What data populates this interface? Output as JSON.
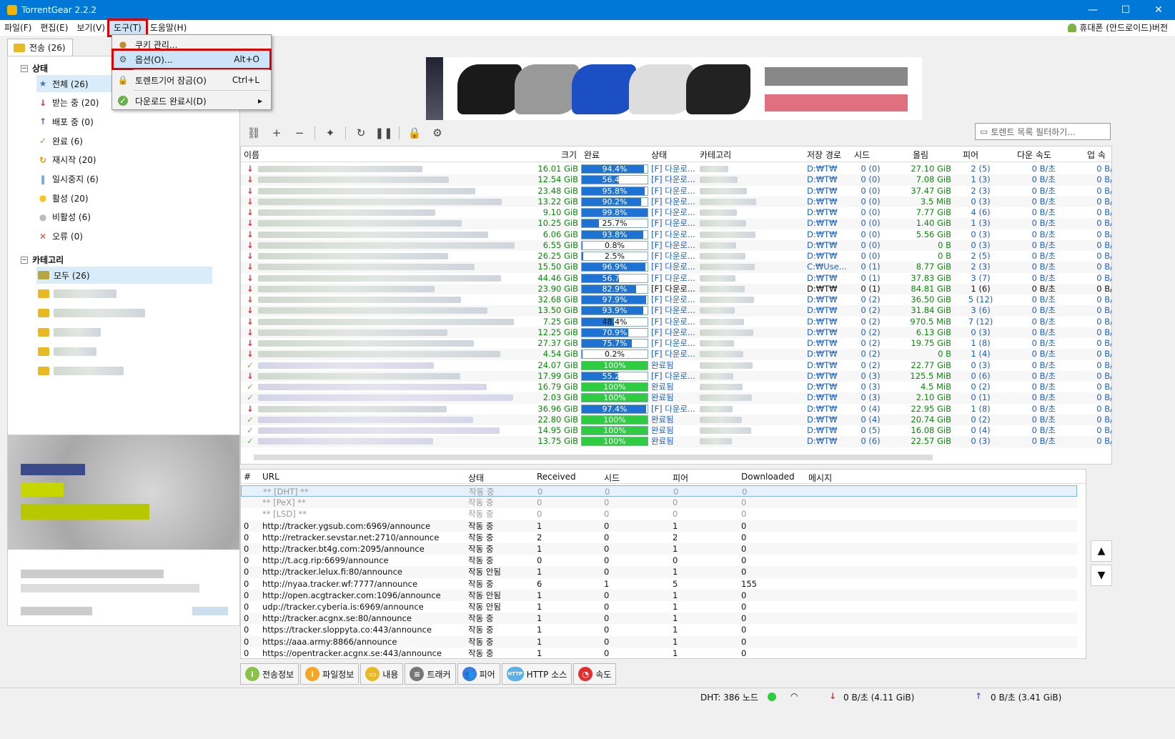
{
  "window": {
    "title": "TorrentGear 2.2.2",
    "minimize": "—",
    "maximize": "☐",
    "close": "✕"
  },
  "menu": {
    "items": [
      "파일(F)",
      "편집(E)",
      "보기(V)",
      "도구(T)",
      "도움말(H)"
    ],
    "mobile": "휴대폰 (안드로이드)버전"
  },
  "tab": {
    "label": "전송 (26)"
  },
  "dropdown": {
    "items": [
      {
        "label": "쿠키 관리...",
        "shortcut": ""
      },
      {
        "label": "옵션(O)...",
        "shortcut": "Alt+O"
      },
      {
        "label": "토렌트기어 잠금(O)",
        "shortcut": "Ctrl+L"
      },
      {
        "label": "다운로드 완료시(D)",
        "shortcut": "▸"
      }
    ]
  },
  "tree": {
    "status_title": "상태",
    "status": [
      {
        "label": "전체 (26)",
        "icon": "★",
        "color": "#4a78b8"
      },
      {
        "label": "받는 중 (20)",
        "icon": "↓",
        "color": "#e03030"
      },
      {
        "label": "배포 중 (0)",
        "icon": "↑",
        "color": "#6a5acd"
      },
      {
        "label": "완료 (6)",
        "icon": "✓",
        "color": "#6ab04c"
      },
      {
        "label": "재시작 (20)",
        "icon": "↻",
        "color": "#f08c00"
      },
      {
        "label": "일시중지 (6)",
        "icon": "‖",
        "color": "#1e90ff"
      },
      {
        "label": "활성 (20)",
        "icon": "●",
        "color": "#f5c518"
      },
      {
        "label": "비활성 (6)",
        "icon": "●",
        "color": "#bbbbbb"
      },
      {
        "label": "오류 (0)",
        "icon": "✕",
        "color": "#e8452c"
      }
    ],
    "category_title": "카테고리",
    "categories": [
      {
        "label": "모두 (26)"
      }
    ]
  },
  "filter": {
    "placeholder": "토렌트 목록 필터하기..."
  },
  "grid": {
    "headers": {
      "name": "이름",
      "size": "크기",
      "done": "완료",
      "state": "상태",
      "cat": "카테고리",
      "path": "저장 경로",
      "seed": "시드",
      "up": "올림",
      "peer": "피어",
      "dl": "다운 속도",
      "ul": "업 속"
    },
    "rows": [
      {
        "t": "d",
        "size": "16.01 GiB",
        "pct": 94.4,
        "pcttxt": "94.4%",
        "state": "[F] 다운로...",
        "path": "D:₩T₩",
        "seed": "0 (0)",
        "up": "27.10 GiB",
        "peer": "2 (5)",
        "dl": "0 B/초",
        "ul": "0 B/"
      },
      {
        "t": "d",
        "size": "12.54 GiB",
        "pct": 56.4,
        "pcttxt": "56.4%",
        "state": "[F] 다운로...",
        "path": "D:₩T₩",
        "seed": "0 (0)",
        "up": "7.08 GiB",
        "peer": "1 (3)",
        "dl": "0 B/초",
        "ul": "0 B/"
      },
      {
        "t": "d",
        "size": "23.48 GiB",
        "pct": 95.8,
        "pcttxt": "95.8%",
        "state": "[F] 다운로...",
        "path": "D:₩T₩",
        "seed": "0 (0)",
        "up": "37.47 GiB",
        "peer": "2 (3)",
        "dl": "0 B/초",
        "ul": "0 B/"
      },
      {
        "t": "d",
        "size": "13.22 GiB",
        "pct": 90.2,
        "pcttxt": "90.2%",
        "state": "[F] 다운로...",
        "path": "D:₩T₩",
        "seed": "0 (0)",
        "up": "3.5 MiB",
        "peer": "0 (3)",
        "dl": "0 B/초",
        "ul": "0 B/"
      },
      {
        "t": "d",
        "size": "9.10 GiB",
        "pct": 99.8,
        "pcttxt": "99.8%",
        "state": "[F] 다운로...",
        "path": "D:₩T₩",
        "seed": "0 (0)",
        "up": "7.77 GiB",
        "peer": "4 (6)",
        "dl": "0 B/초",
        "ul": "0 B/"
      },
      {
        "t": "d",
        "size": "10.25 GiB",
        "pct": 25.7,
        "pcttxt": "25.7%",
        "state": "[F] 다운로...",
        "path": "D:₩T₩",
        "seed": "0 (0)",
        "up": "1.40 GiB",
        "peer": "1 (3)",
        "dl": "0 B/초",
        "ul": "0 B/"
      },
      {
        "t": "d",
        "size": "6.06 GiB",
        "pct": 93.8,
        "pcttxt": "93.8%",
        "state": "[F] 다운로...",
        "path": "D:₩T₩",
        "seed": "0 (0)",
        "up": "5.56 GiB",
        "peer": "0 (3)",
        "dl": "0 B/초",
        "ul": "0 B/"
      },
      {
        "t": "d",
        "size": "6.55 GiB",
        "pct": 0.8,
        "pcttxt": "0.8%",
        "state": "[F] 다운로...",
        "path": "D:₩T₩",
        "seed": "0 (0)",
        "up": "0 B",
        "peer": "0 (3)",
        "dl": "0 B/초",
        "ul": "0 B/"
      },
      {
        "t": "d",
        "size": "26.25 GiB",
        "pct": 2.5,
        "pcttxt": "2.5%",
        "state": "[F] 다운로...",
        "path": "D:₩T₩",
        "seed": "0 (0)",
        "up": "0 B",
        "peer": "2 (5)",
        "dl": "0 B/초",
        "ul": "0 B/"
      },
      {
        "t": "d",
        "size": "15.50 GiB",
        "pct": 96.9,
        "pcttxt": "96.9%",
        "state": "[F] 다운로...",
        "path": "C:₩Use...",
        "seed": "0 (1)",
        "up": "8.77 GiB",
        "peer": "2 (3)",
        "dl": "0 B/초",
        "ul": "0 B/"
      },
      {
        "t": "d",
        "size": "44.46 GiB",
        "pct": 56.7,
        "pcttxt": "56.7%",
        "state": "[F] 다운로...",
        "path": "D:₩T₩",
        "seed": "0 (1)",
        "up": "37.83 GiB",
        "peer": "3 (7)",
        "dl": "0 B/초",
        "ul": "0 B/"
      },
      {
        "t": "d",
        "size": "23.90 GiB",
        "pct": 82.9,
        "pcttxt": "82.9%",
        "state": "[F] 다운로...",
        "path": "D:₩T₩",
        "seed": "0 (1)",
        "up": "84.81 GiB",
        "peer": "1 (6)",
        "dl": "0 B/초",
        "ul": "0 B/",
        "dark": true
      },
      {
        "t": "d",
        "size": "32.68 GiB",
        "pct": 97.9,
        "pcttxt": "97.9%",
        "state": "[F] 다운로...",
        "path": "D:₩T₩",
        "seed": "0 (2)",
        "up": "36.50 GiB",
        "peer": "5 (12)",
        "dl": "0 B/초",
        "ul": "0 B/"
      },
      {
        "t": "d",
        "size": "13.50 GiB",
        "pct": 93.9,
        "pcttxt": "93.9%",
        "state": "[F] 다운로...",
        "path": "D:₩T₩",
        "seed": "0 (2)",
        "up": "31.84 GiB",
        "peer": "3 (6)",
        "dl": "0 B/초",
        "ul": "0 B/"
      },
      {
        "t": "d",
        "size": "7.25 GiB",
        "pct": 48.4,
        "pcttxt": "48.4%",
        "state": "[F] 다운로...",
        "path": "D:₩T₩",
        "seed": "0 (2)",
        "up": "970.5 MiB",
        "peer": "7 (12)",
        "dl": "0 B/초",
        "ul": "0 B/"
      },
      {
        "t": "d",
        "size": "12.25 GiB",
        "pct": 70.9,
        "pcttxt": "70.9%",
        "state": "[F] 다운로...",
        "path": "D:₩T₩",
        "seed": "0 (2)",
        "up": "6.13 GiB",
        "peer": "0 (3)",
        "dl": "0 B/초",
        "ul": "0 B/"
      },
      {
        "t": "d",
        "size": "27.37 GiB",
        "pct": 75.7,
        "pcttxt": "75.7%",
        "state": "[F] 다운로...",
        "path": "D:₩T₩",
        "seed": "0 (2)",
        "up": "19.75 GiB",
        "peer": "1 (8)",
        "dl": "0 B/초",
        "ul": "0 B/"
      },
      {
        "t": "d",
        "size": "4.54 GiB",
        "pct": 0.2,
        "pcttxt": "0.2%",
        "state": "[F] 다운로...",
        "path": "D:₩T₩",
        "seed": "0 (2)",
        "up": "0 B",
        "peer": "1 (4)",
        "dl": "0 B/초",
        "ul": "0 B/"
      },
      {
        "t": "c",
        "size": "24.07 GiB",
        "pct": 100,
        "pcttxt": "100%",
        "state": "완료됨",
        "path": "D:₩T₩",
        "seed": "0 (2)",
        "up": "22.77 GiB",
        "peer": "0 (3)",
        "dl": "0 B/초",
        "ul": "0 B/"
      },
      {
        "t": "d",
        "size": "17.99 GiB",
        "pct": 55.2,
        "pcttxt": "55.2%",
        "state": "[F] 다운로...",
        "path": "D:₩T₩",
        "seed": "0 (3)",
        "up": "125.5 MiB",
        "peer": "0 (6)",
        "dl": "0 B/초",
        "ul": "0 B/"
      },
      {
        "t": "c",
        "size": "16.79 GiB",
        "pct": 100,
        "pcttxt": "100%",
        "state": "완료됨",
        "path": "D:₩T₩",
        "seed": "0 (3)",
        "up": "4.5 MiB",
        "peer": "0 (2)",
        "dl": "0 B/초",
        "ul": "0 B/"
      },
      {
        "t": "c",
        "size": "2.03 GiB",
        "pct": 100,
        "pcttxt": "100%",
        "state": "완료됨",
        "path": "D:₩T₩",
        "seed": "0 (3)",
        "up": "2.10 GiB",
        "peer": "0 (1)",
        "dl": "0 B/초",
        "ul": "0 B/"
      },
      {
        "t": "d",
        "size": "36.96 GiB",
        "pct": 97.4,
        "pcttxt": "97.4%",
        "state": "[F] 다운로...",
        "path": "D:₩T₩",
        "seed": "0 (4)",
        "up": "22.95 GiB",
        "peer": "1 (8)",
        "dl": "0 B/초",
        "ul": "0 B/"
      },
      {
        "t": "c",
        "size": "22.80 GiB",
        "pct": 100,
        "pcttxt": "100%",
        "state": "완료됨",
        "path": "D:₩T₩",
        "seed": "0 (4)",
        "up": "20.74 GiB",
        "peer": "0 (2)",
        "dl": "0 B/초",
        "ul": "0 B/"
      },
      {
        "t": "c",
        "size": "14.95 GiB",
        "pct": 100,
        "pcttxt": "100%",
        "state": "완료됨",
        "path": "D:₩T₩",
        "seed": "0 (5)",
        "up": "16.08 GiB",
        "peer": "0 (4)",
        "dl": "0 B/초",
        "ul": "0 B/"
      },
      {
        "t": "c",
        "size": "13.75 GiB",
        "pct": 100,
        "pcttxt": "100%",
        "state": "완료됨",
        "path": "D:₩T₩",
        "seed": "0 (6)",
        "up": "22.57 GiB",
        "peer": "0 (3)",
        "dl": "0 B/초",
        "ul": "0 B/"
      }
    ]
  },
  "trackers": {
    "headers": {
      "num": "#",
      "url": "URL",
      "state": "상태",
      "recv": "Received",
      "seed": "시드",
      "peer": "피어",
      "down": "Downloaded",
      "msg": "메시지"
    },
    "rows": [
      {
        "num": "",
        "url": "** [DHT] **",
        "state": "작동 중",
        "recv": "0",
        "seed": "0",
        "peer": "0",
        "down": "0",
        "gray": true,
        "sel": true
      },
      {
        "num": "",
        "url": "** [PeX] **",
        "state": "작동 중",
        "recv": "0",
        "seed": "0",
        "peer": "0",
        "down": "0",
        "gray": true
      },
      {
        "num": "",
        "url": "** [LSD] **",
        "state": "작동 중",
        "recv": "0",
        "seed": "0",
        "peer": "0",
        "down": "0",
        "gray": true
      },
      {
        "num": "0",
        "url": "http://tracker.ygsub.com:6969/announce",
        "state": "작동 중",
        "recv": "1",
        "seed": "0",
        "peer": "1",
        "down": "0"
      },
      {
        "num": "0",
        "url": "http://retracker.sevstar.net:2710/announce",
        "state": "작동 중",
        "recv": "2",
        "seed": "0",
        "peer": "2",
        "down": "0"
      },
      {
        "num": "0",
        "url": "http://tracker.bt4g.com:2095/announce",
        "state": "작동 중",
        "recv": "1",
        "seed": "0",
        "peer": "1",
        "down": "0"
      },
      {
        "num": "0",
        "url": "http://t.acg.rip:6699/announce",
        "state": "작동 중",
        "recv": "0",
        "seed": "0",
        "peer": "0",
        "down": "0"
      },
      {
        "num": "0",
        "url": "http://tracker.lelux.fi:80/announce",
        "state": "작동 안됨",
        "recv": "1",
        "seed": "0",
        "peer": "1",
        "down": "0"
      },
      {
        "num": "0",
        "url": "http://nyaa.tracker.wf:7777/announce",
        "state": "작동 중",
        "recv": "6",
        "seed": "1",
        "peer": "5",
        "down": "155"
      },
      {
        "num": "0",
        "url": "http://open.acgtracker.com:1096/announce",
        "state": "작동 안됨",
        "recv": "1",
        "seed": "0",
        "peer": "1",
        "down": "0"
      },
      {
        "num": "0",
        "url": "udp://tracker.cyberia.is:6969/announce",
        "state": "작동 안됨",
        "recv": "1",
        "seed": "0",
        "peer": "1",
        "down": "0"
      },
      {
        "num": "0",
        "url": "http://tracker.acgnx.se:80/announce",
        "state": "작동 중",
        "recv": "1",
        "seed": "0",
        "peer": "1",
        "down": "0"
      },
      {
        "num": "0",
        "url": "https://tracker.sloppyta.co:443/announce",
        "state": "작동 중",
        "recv": "1",
        "seed": "0",
        "peer": "1",
        "down": "0"
      },
      {
        "num": "0",
        "url": "https://aaa.army:8866/announce",
        "state": "작동 중",
        "recv": "1",
        "seed": "0",
        "peer": "1",
        "down": "0"
      },
      {
        "num": "0",
        "url": "https://opentracker.acgnx.se:443/announce",
        "state": "작동 중",
        "recv": "1",
        "seed": "0",
        "peer": "1",
        "down": "0"
      }
    ]
  },
  "bottomtabs": [
    {
      "label": "전송정보",
      "icon": "i",
      "color": "#8bc34a"
    },
    {
      "label": "파일정보",
      "icon": "i",
      "color": "#f5a623"
    },
    {
      "label": "내용",
      "icon": "▭",
      "color": "#e8b923"
    },
    {
      "label": "트래커",
      "icon": "≡",
      "color": "#777777"
    },
    {
      "label": "피어",
      "icon": "👥",
      "color": "#3b7ddd"
    },
    {
      "label": "HTTP 소스",
      "icon": "HTTP",
      "color": "#5ab0e8"
    },
    {
      "label": "속도",
      "icon": "◔",
      "color": "#e03030"
    }
  ],
  "status": {
    "dht": "DHT: 386 노드",
    "down": "0 B/초 (4.11 GiB)",
    "up": "0 B/초 (3.41 GiB)"
  },
  "colors": {
    "accent": "#0078d7",
    "progress": "#1e72d4",
    "complete": "#2ecc40",
    "highlight": "#e00000"
  }
}
